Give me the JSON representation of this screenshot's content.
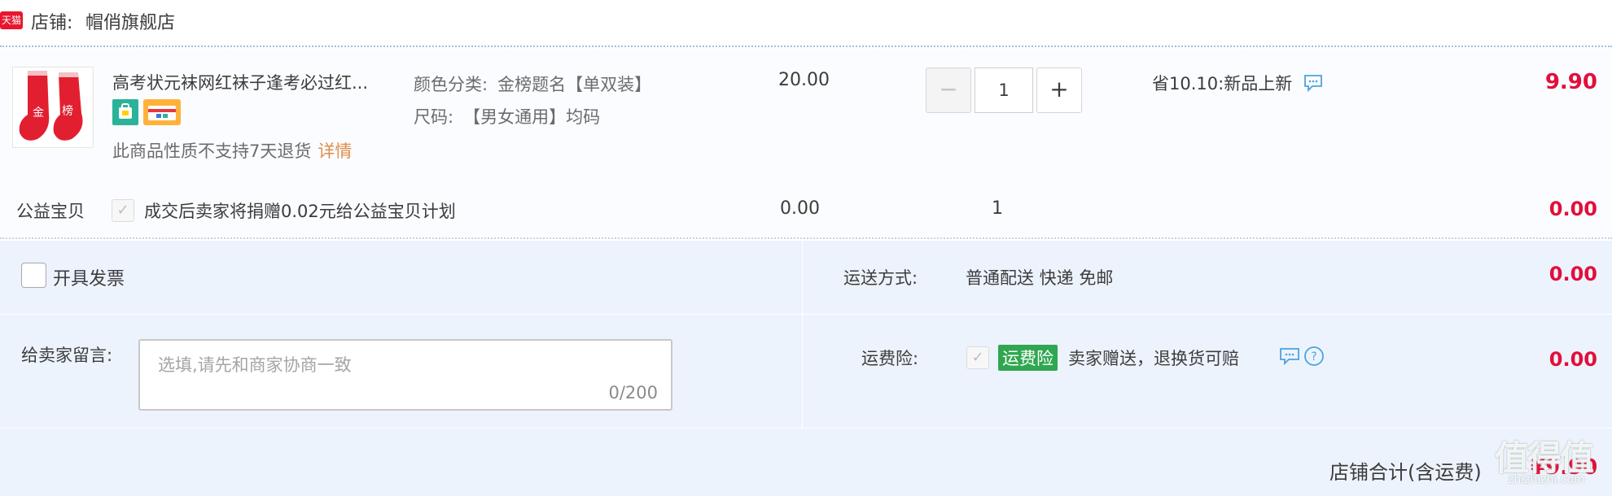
{
  "shop": {
    "badge": "天猫",
    "label": "店铺:",
    "name": "帽俏旗舰店"
  },
  "item": {
    "title": "高考状元袜网红袜子逢考必过红...",
    "no_return_text": "此商品性质不支持7天退货",
    "detail_link": "详情",
    "sku": [
      {
        "label": "颜色分类:",
        "value": "金榜题名【单双装】"
      },
      {
        "label": "尺码:",
        "value": "【男女通用】均码"
      }
    ],
    "unit_price": "20.00",
    "quantity": "1",
    "minus_label": "−",
    "plus_label": "+",
    "promo": "省10.10:新品上新",
    "subtotal": "9.90"
  },
  "charity": {
    "label": "公益宝贝",
    "text": "成交后卖家将捐赠0.02元给公益宝贝计划",
    "price": "0.00",
    "qty": "1",
    "total": "0.00"
  },
  "invoice": {
    "label": "开具发票"
  },
  "shipping": {
    "label": "运送方式:",
    "value": "普通配送 快递 免邮",
    "total": "0.00"
  },
  "message": {
    "label": "给卖家留言:",
    "placeholder": "选填,请先和商家协商一致",
    "counter": "0/200"
  },
  "insurance": {
    "label": "运费险:",
    "tag": "运费险",
    "desc": "卖家赠送，退换货可赔",
    "total": "0.00"
  },
  "summary": {
    "label": "店铺合计(含运费)",
    "value": "¥9.90"
  },
  "watermark": {
    "main": "值得值",
    "sub": "zhizhizhi.com"
  },
  "icons": {
    "tmall": "tmall-badge-icon",
    "chat": "chat-bubble-icon",
    "help": "question-circle-icon",
    "check": "check-icon"
  },
  "colors": {
    "price_red": "#e20f3a",
    "panel_bg": "#edf3fc",
    "tag_green": "#2fa751",
    "link_orange": "#e18d4a"
  }
}
